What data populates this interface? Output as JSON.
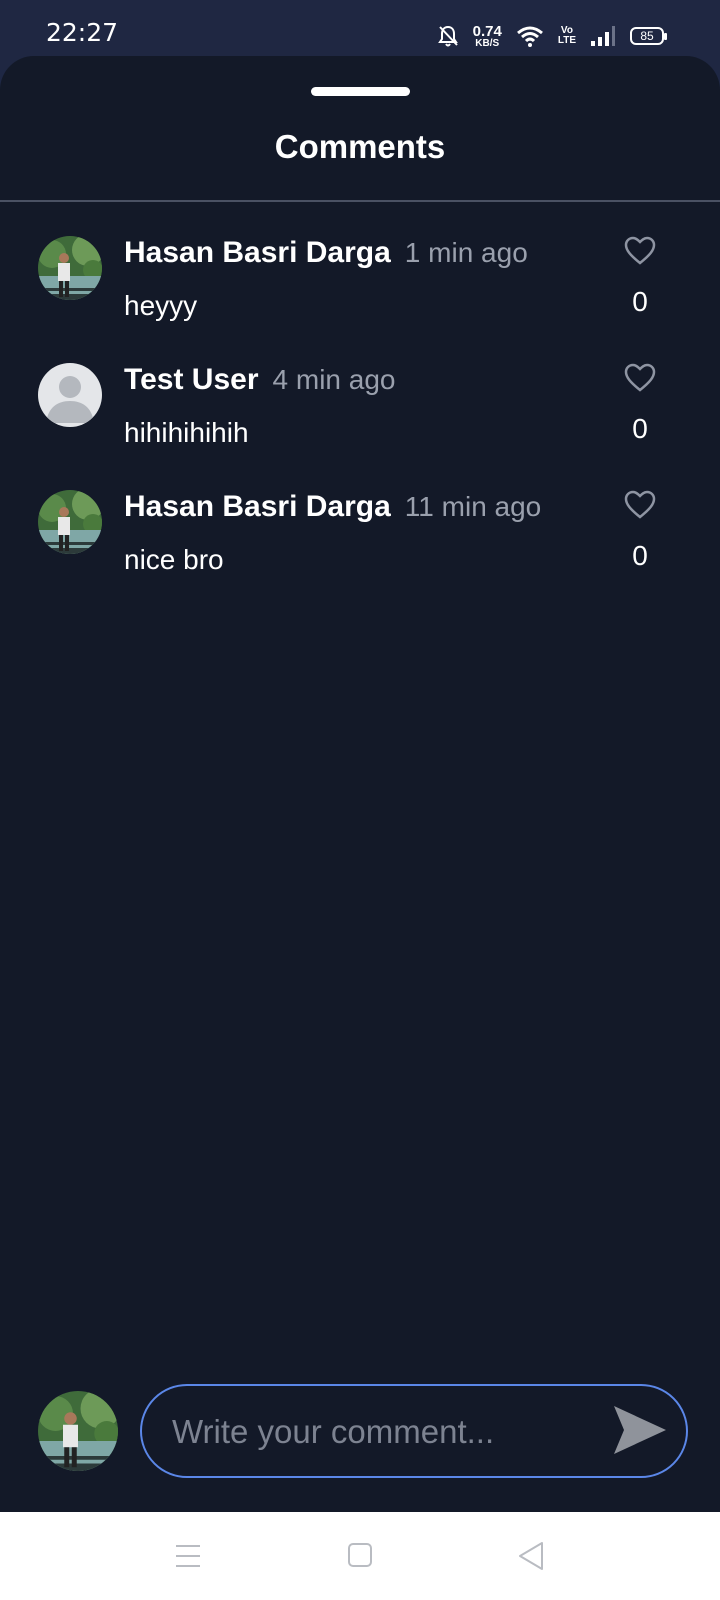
{
  "status_bar": {
    "time": "22:27",
    "net_speed_value": "0.74",
    "net_speed_unit": "KB/S",
    "volte_top": "Vo",
    "volte_bottom": "LTE",
    "battery": "85",
    "icons": [
      "mute-bell-icon",
      "wifi-icon",
      "signal-icon",
      "battery-icon"
    ]
  },
  "sheet": {
    "title": "Comments"
  },
  "comments": [
    {
      "author": "Hasan Basri Darga",
      "time": "1 min ago",
      "text": "heyyy",
      "likes": "0",
      "avatar": "photo"
    },
    {
      "author": "Test User",
      "time": "4 min ago",
      "text": "hihihihihih",
      "likes": "0",
      "avatar": "default"
    },
    {
      "author": "Hasan Basri Darga",
      "time": "11 min ago",
      "text": "nice bro",
      "likes": "0",
      "avatar": "photo"
    }
  ],
  "composer": {
    "placeholder": "Write your comment...",
    "value": ""
  },
  "colors": {
    "background": "#131928",
    "status_bar": "#1f2742",
    "accent_border": "#5b87e8",
    "muted_text": "#9aa0ad"
  }
}
